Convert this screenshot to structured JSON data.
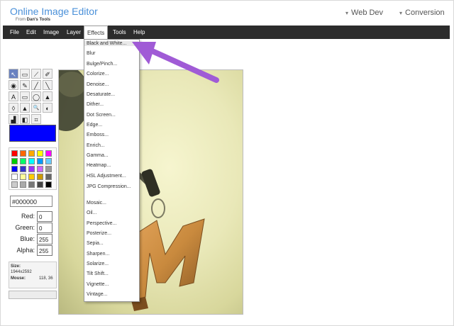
{
  "header": {
    "title": "Online Image Editor",
    "subtitle_prefix": "From",
    "subtitle_brand": "Dan's Tools",
    "links": [
      "Web Dev",
      "Conversion"
    ]
  },
  "menubar": {
    "items": [
      "File",
      "Edit",
      "Image",
      "Layer",
      "Effects",
      "Tools",
      "Help"
    ],
    "active": "Effects"
  },
  "effects_menu": {
    "items": [
      "Black and White...",
      "Blur",
      "Bulge/Pinch...",
      "Colorize...",
      "Denoise...",
      "Desaturate...",
      "Dither...",
      "Dot Screen...",
      "Edge...",
      "Emboss...",
      "Enrich...",
      "Gamma...",
      "Heatmap...",
      "HSL Adjustment...",
      "JPG Compression...",
      "Mosaic...",
      "Oil...",
      "Perspective...",
      "Posterize...",
      "Sepia...",
      "Sharpen...",
      "Solarize...",
      "Tilt Shift...",
      "Vignette...",
      "Vintage..."
    ],
    "highlighted": "Black and White..."
  },
  "tools": {
    "icons": [
      "pointer-icon",
      "rect-select-icon",
      "magic-wand-icon",
      "eraser-icon",
      "fill-icon",
      "eyedropper-icon",
      "brush-icon",
      "line-icon",
      "text-icon",
      "rectangle-icon",
      "ellipse-icon",
      "spray-icon",
      "drop-icon",
      "sharpen-icon",
      "zoom-icon",
      "smudge-icon",
      "burn-icon",
      "gradient-icon",
      "crop-icon"
    ],
    "glyphs": [
      "↖",
      "▭",
      "⟋",
      "✐",
      "◉",
      "✎",
      "╱",
      "╲",
      "A",
      "▭",
      "◯",
      "▲",
      "◊",
      "▲",
      "🔍",
      "◐",
      "▟",
      "◧",
      "⌗"
    ]
  },
  "color": {
    "primary": "#0000FF",
    "hex": "#000000",
    "palette": [
      "#ff0000",
      "#ff6600",
      "#ffaa00",
      "#ffff00",
      "#ff00ff",
      "#00cc00",
      "#00ff66",
      "#00ffff",
      "#0099ff",
      "#66ccff",
      "#0000ff",
      "#3333cc",
      "#9933ff",
      "#cc66ff",
      "#999999",
      "#ffffff",
      "#ffff99",
      "#ffcc00",
      "#cc9900",
      "#666666",
      "#cccccc",
      "#aaaaaa",
      "#777777",
      "#444444",
      "#000000"
    ],
    "labels": {
      "red": "Red:",
      "green": "Green:",
      "blue": "Blue:",
      "alpha": "Alpha:"
    },
    "values": {
      "red": "0",
      "green": "0",
      "blue": "255",
      "alpha": "255"
    }
  },
  "info": {
    "size_label": "Size:",
    "size_value": "1944x2592",
    "mouse_label": "Mouse:",
    "mouse_value": "118, 36"
  },
  "annotation": {
    "color": "#a05bd6"
  }
}
